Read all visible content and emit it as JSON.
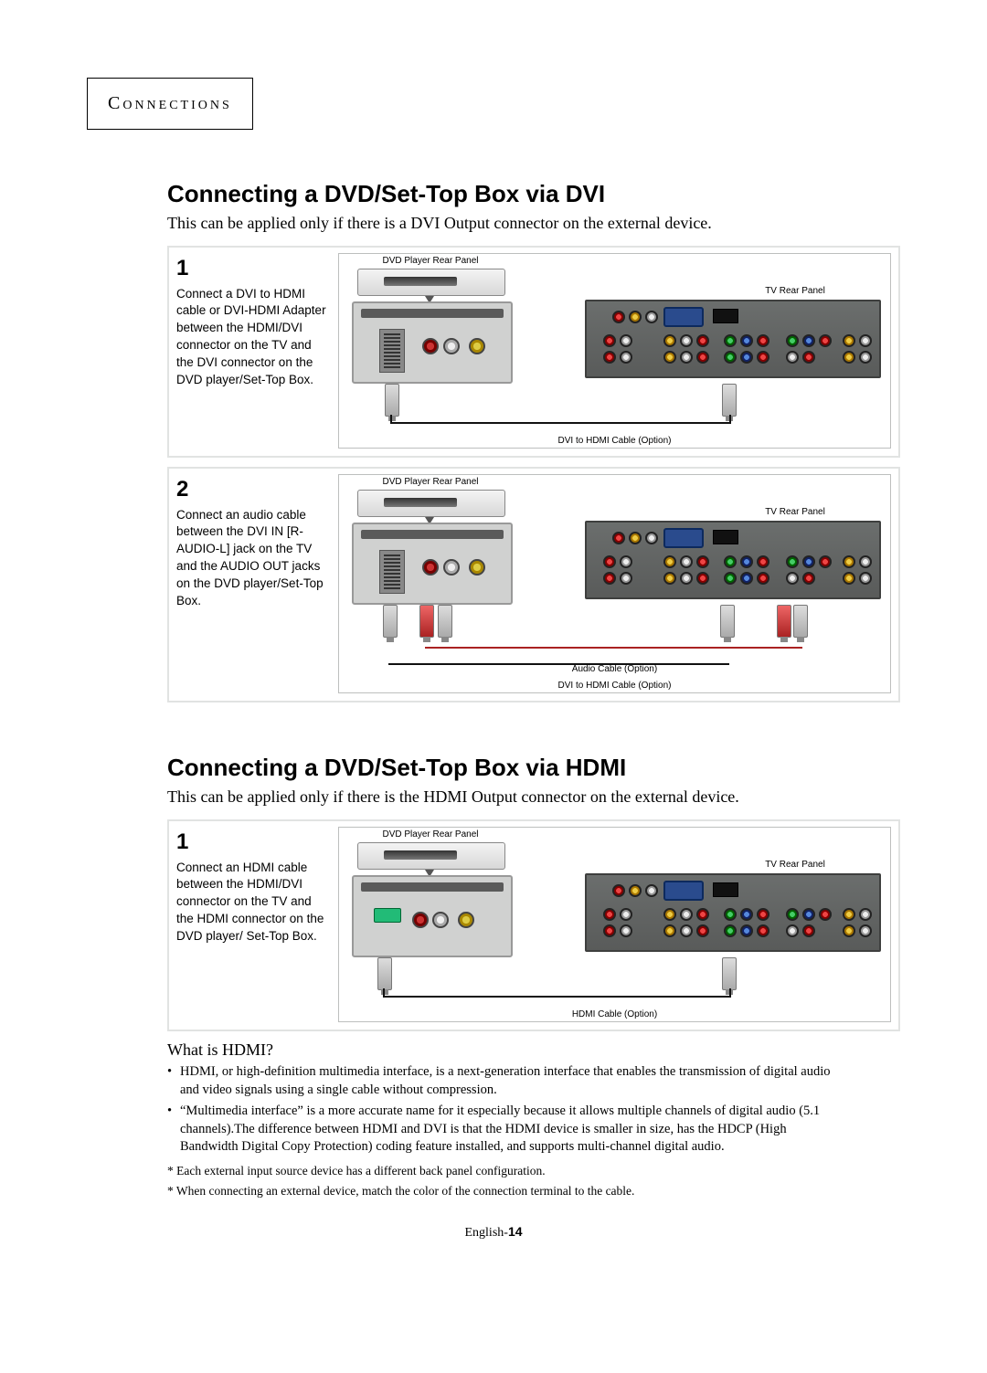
{
  "chapter": "Connections",
  "section_dvi": {
    "title": "Connecting a DVD/Set-Top Box via DVI",
    "subtitle": "This can be applied only if there is a DVI Output connector on the external device.",
    "step1": {
      "num": "1",
      "text": "Connect a DVI to HDMI cable or DVI-HDMI Adapter between the HDMI/DVI connector on the TV and the DVI connector on the DVD player/Set-Top Box.",
      "dvd_label": "DVD Player Rear Panel",
      "tv_label": "TV Rear Panel",
      "cable_label": "DVI to HDMI Cable (Option)"
    },
    "step2": {
      "num": "2",
      "text": "Connect an audio cable between the DVI IN [R-AUDIO-L] jack on the TV and the AUDIO OUT jacks on the DVD player/Set-Top Box.",
      "dvd_label": "DVD Player Rear Panel",
      "tv_label": "TV Rear Panel",
      "audio_cable_label": "Audio Cable (Option)",
      "cable_label": "DVI to HDMI Cable (Option)"
    }
  },
  "section_hdmi": {
    "title": "Connecting a DVD/Set-Top Box via HDMI",
    "subtitle": "This can be applied only if there is the HDMI Output connector on the external device.",
    "step1": {
      "num": "1",
      "text": "Connect an HDMI cable between the HDMI/DVI connector on the TV and the HDMI connector on the DVD player/ Set-Top Box.",
      "dvd_label": "DVD Player Rear Panel",
      "tv_label": "TV Rear Panel",
      "cable_label": "HDMI Cable (Option)"
    }
  },
  "hdmi_info": {
    "heading": "What is HDMI?",
    "bullets": [
      "HDMI, or high-definition multimedia interface, is a next-generation interface that enables the transmission of digital audio and video signals using a single cable without compression.",
      "“Multimedia interface” is a more accurate name for it especially because it allows multiple channels of digital audio (5.1 channels).The difference between HDMI and DVI is that the HDMI device is smaller in size, has the HDCP (High Bandwidth Digital Copy Protection) coding feature installed, and supports multi-channel digital audio."
    ],
    "notes": [
      "*  Each external input source device has a different back panel configuration.",
      "* When connecting an external device, match the color of the connection terminal to the cable."
    ]
  },
  "page_label": {
    "lang": "English-",
    "num": "14"
  }
}
